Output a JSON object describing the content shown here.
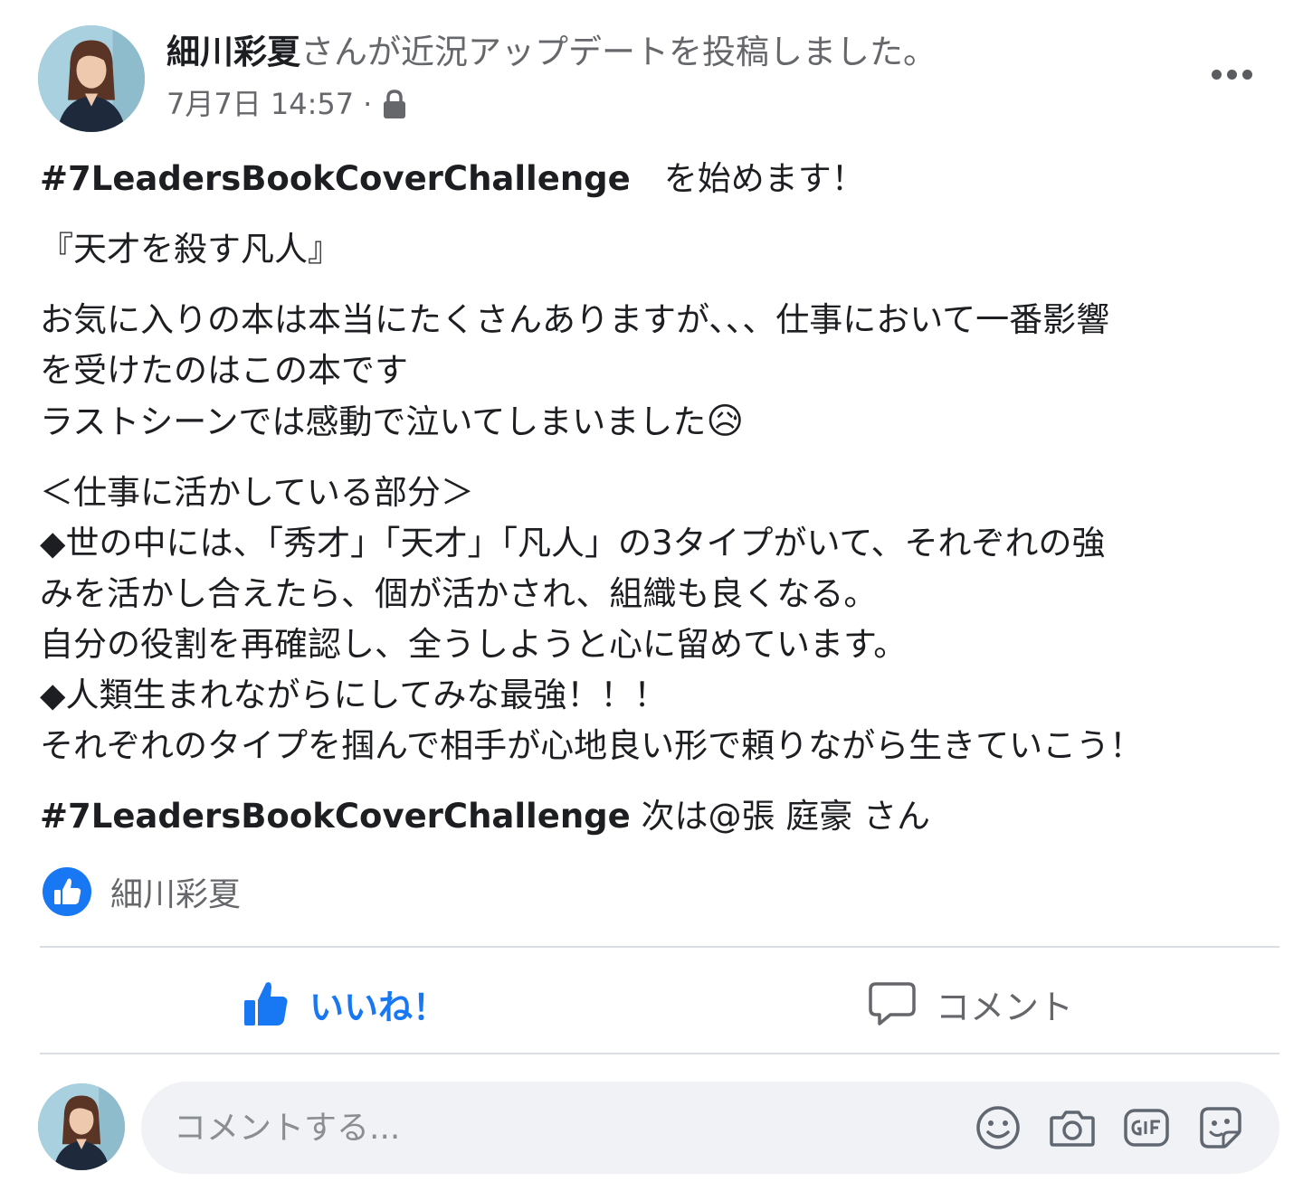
{
  "post": {
    "author": "細川彩夏",
    "action_text": "さんが近況アップデートを投稿しました。",
    "timestamp": "7月7日 14:57",
    "separator": "·",
    "privacy_icon": "lock-icon",
    "more_icon": "more-options-icon"
  },
  "content": {
    "hashtag_intro": "#7LeadersBookCoverChallenge",
    "intro_suffix": "　を始めます！",
    "book_title": "『天才を殺す凡人』",
    "para1_line1": "お気に入りの本は本当にたくさんありますが、、、仕事において一番影響",
    "para1_line2": "を受けたのはこの本です",
    "para1_line3": "ラストシーンでは感動で泣いてしまいました",
    "emoji": "😥",
    "section_heading": "＜仕事に活かしている部分＞",
    "point1_line1": "◆世の中には、「秀才」「天才」「凡人」の3タイプがいて、それぞれの強",
    "point1_line2": "みを活かし合えたら、個が活かされ、組織も良くなる。",
    "point1_line3": "自分の役割を再確認し、全うしようと心に留めています。",
    "point2_line1": "◆人類生まれながらにしてみな最強！！！",
    "point2_line2": "それぞれのタイプを掴んで相手が心地良い形で頼りながら生きていこう！",
    "hashtag_outro": "#7LeadersBookCoverChallenge",
    "outro_next": " 次は",
    "mention": "@張 庭豪",
    "mention_suffix": " さん"
  },
  "reactions": {
    "icon": "like-reaction-icon",
    "names": "細川彩夏"
  },
  "actions": {
    "like_label": "いいね！",
    "comment_label": "コメント"
  },
  "comment_composer": {
    "placeholder": "コメントする...",
    "tools": [
      "emoji-icon",
      "camera-icon",
      "gif-icon",
      "sticker-icon"
    ]
  },
  "colors": {
    "accent": "#1877f2",
    "secondary_text": "#65676b",
    "input_bg": "#f0f2f5",
    "divider": "#dadde1"
  }
}
